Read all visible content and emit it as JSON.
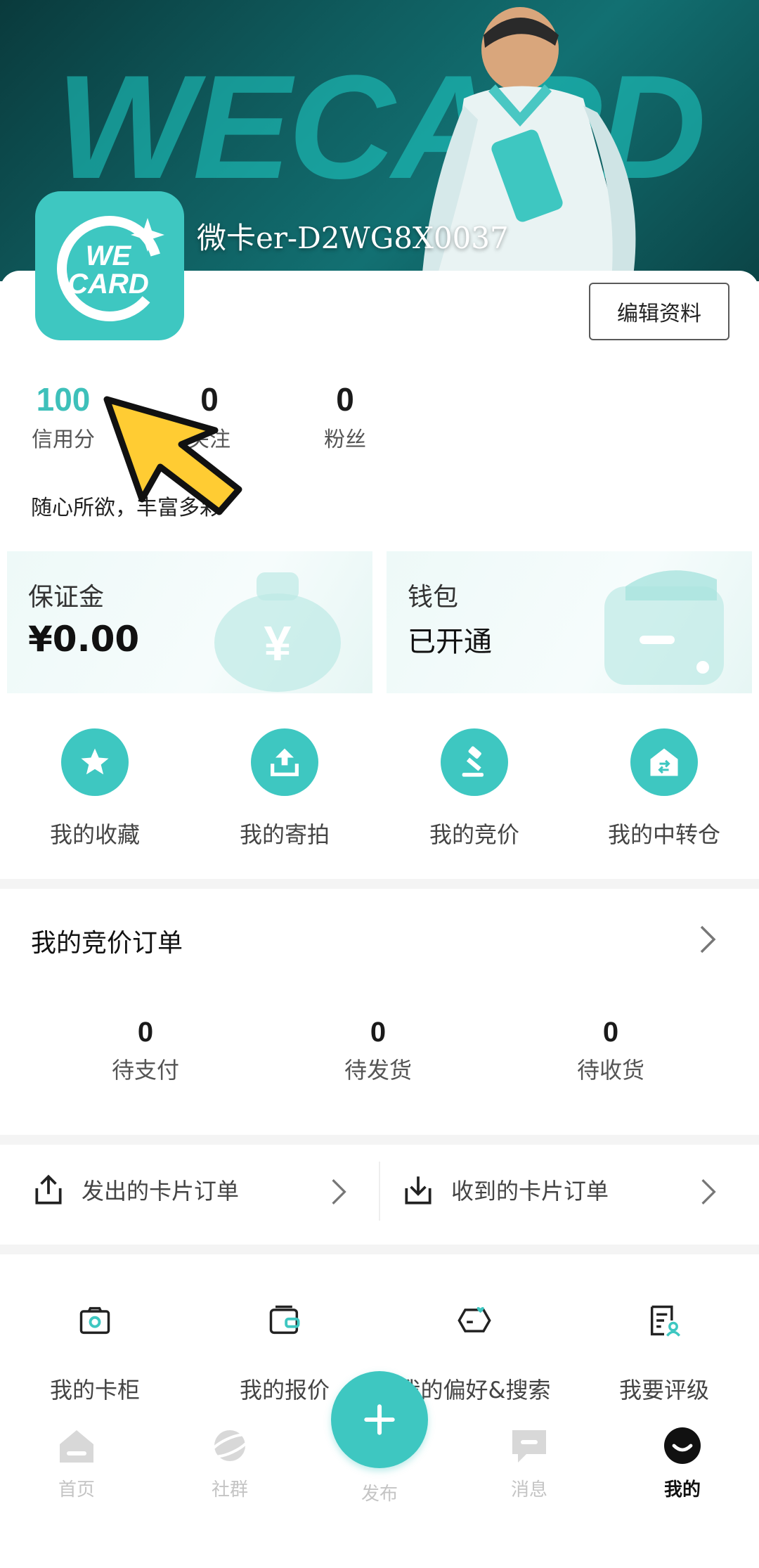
{
  "banner": {
    "watermark": "WECARD",
    "profile_name": "微卡er-D2WG8X0037"
  },
  "logo": {
    "line1": "WE",
    "line2": "CARD"
  },
  "profile": {
    "edit_label": "编辑资料",
    "bio": "随心所欲，丰富多彩"
  },
  "stats": [
    {
      "value": "100",
      "label": "信用分"
    },
    {
      "value": "0",
      "label": "关注"
    },
    {
      "value": "0",
      "label": "粉丝"
    }
  ],
  "deposit": {
    "title": "保证金",
    "value": "¥0.00"
  },
  "wallet": {
    "title": "钱包",
    "status": "已开通"
  },
  "quick_actions": [
    {
      "label": "我的收藏",
      "icon": "star-icon"
    },
    {
      "label": "我的寄拍",
      "icon": "upload-icon"
    },
    {
      "label": "我的竞价",
      "icon": "gavel-icon"
    },
    {
      "label": "我的中转仓",
      "icon": "warehouse-icon"
    }
  ],
  "bidding_orders": {
    "title": "我的竞价订单",
    "items": [
      {
        "value": "0",
        "label": "待支付"
      },
      {
        "value": "0",
        "label": "待发货"
      },
      {
        "value": "0",
        "label": "待收货"
      }
    ]
  },
  "card_orders": {
    "sent": "发出的卡片订单",
    "received": "收到的卡片订单"
  },
  "tools": [
    {
      "label": "我的卡柜",
      "icon": "card-cabinet-icon"
    },
    {
      "label": "我的报价",
      "icon": "quote-icon"
    },
    {
      "label": "我的偏好&搜索",
      "icon": "preference-icon"
    },
    {
      "label": "我要评级",
      "icon": "grading-icon"
    }
  ],
  "tabbar": {
    "home": "首页",
    "community": "社群",
    "publish": "发布",
    "messages": "消息",
    "me": "我的"
  },
  "colors": {
    "accent": "#3ec7c1",
    "credit": "#3ec0ba",
    "pointer": "#ffcc33"
  }
}
